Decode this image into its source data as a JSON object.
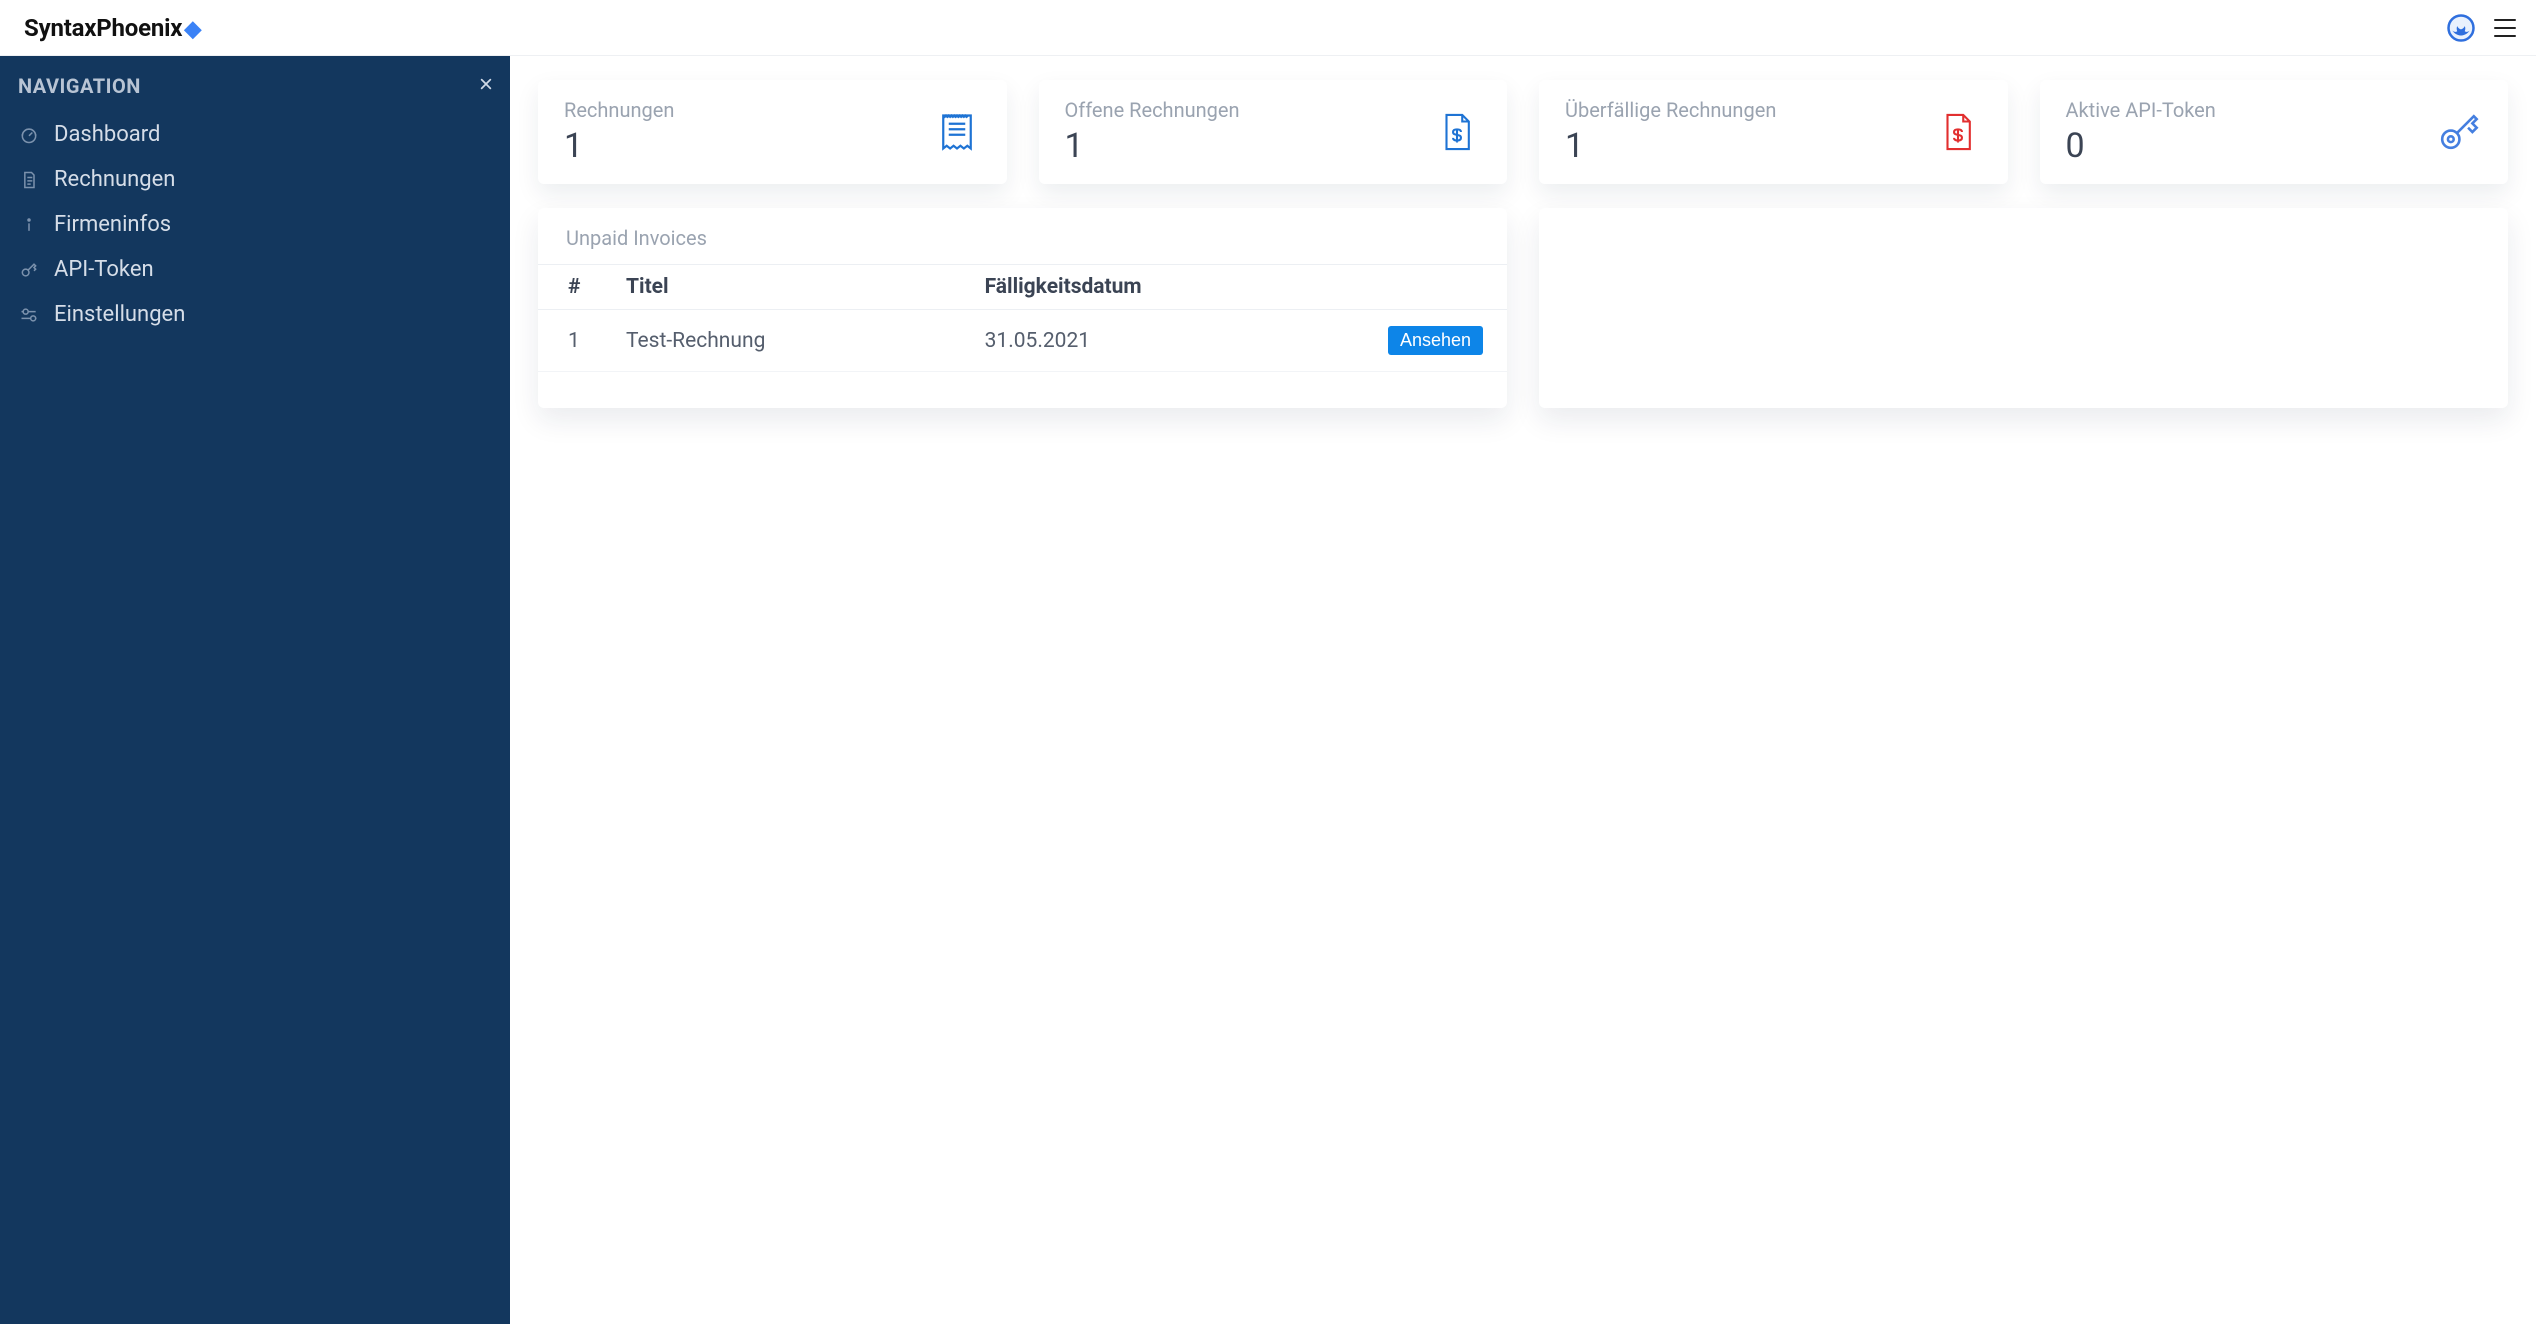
{
  "brand": "SyntaxPhoenix",
  "sidebar": {
    "heading": "NAVIGATION",
    "items": [
      {
        "label": "Dashboard"
      },
      {
        "label": "Rechnungen"
      },
      {
        "label": "Firmeninfos"
      },
      {
        "label": "API-Token"
      },
      {
        "label": "Einstellungen"
      }
    ]
  },
  "stats": [
    {
      "label": "Rechnungen",
      "value": "1"
    },
    {
      "label": "Offene Rechnungen",
      "value": "1"
    },
    {
      "label": "Überfällige Rechnungen",
      "value": "1"
    },
    {
      "label": "Aktive API-Token",
      "value": "0"
    }
  ],
  "unpaid_panel": {
    "title": "Unpaid Invoices",
    "columns": {
      "num": "#",
      "title": "Titel",
      "due": "Fälligkeitsdatum"
    },
    "rows": [
      {
        "num": "1",
        "title": "Test-Rechnung",
        "due": "31.05.2021",
        "action": "Ansehen"
      }
    ]
  },
  "colors": {
    "blue": "#1e73d4",
    "red": "#e22f2f",
    "keyblue": "#457fe0"
  }
}
